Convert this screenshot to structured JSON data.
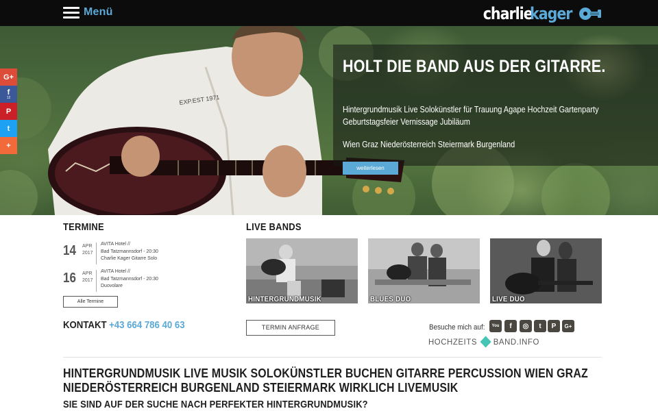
{
  "header": {
    "menu_label": "Menü",
    "logo_part1": "charlie",
    "logo_part2": "kager",
    "accent": "#5aa9d6"
  },
  "hero": {
    "title": "HOLT DIE BAND AUS DER GITARRE.",
    "line1": "Hintergrundmusik Live Solokünstler für Trauung Agape Hochzeit Gartenparty",
    "line2": "Geburtstagsfeier Vernissage Jubiläum",
    "regions": "Wien Graz Niederösterreich Steiermark Burgenland",
    "button": "weiterlesen"
  },
  "share": {
    "items": [
      {
        "icon": "google-plus-icon",
        "glyph": "G+"
      },
      {
        "icon": "facebook-icon",
        "glyph": "f",
        "count": "12"
      },
      {
        "icon": "pinterest-icon",
        "glyph": "P"
      },
      {
        "icon": "twitter-icon",
        "glyph": "t"
      },
      {
        "icon": "more-plus-icon",
        "glyph": "+"
      }
    ]
  },
  "termine": {
    "heading": "TERMINE",
    "events": [
      {
        "day": "14",
        "month": "APR",
        "year": "2017",
        "l1": "AVITA Hotel //",
        "l2": "Bad Tatzmannsdorf - 20:30",
        "l3": "Charlie Kager Gitarre Solo"
      },
      {
        "day": "16",
        "month": "APR",
        "year": "2017",
        "l1": "AVITA Hotel //",
        "l2": "Bad Tatzmannsdorf - 20:30",
        "l3": "Duovolare"
      }
    ],
    "all_button": "Alle Termine"
  },
  "contact": {
    "label": "KONTAKT",
    "phone": "+43 664 786 40 63"
  },
  "bands": {
    "heading": "LIVE BANDS",
    "items": [
      {
        "label": "HINTERGRUNDMUSIK"
      },
      {
        "label": "BLUES DUO"
      },
      {
        "label": "LIVE DUO"
      }
    ],
    "request_button": "TERMIN ANFRAGE"
  },
  "social": {
    "visit_label": "Besuche mich auf:",
    "icons": [
      {
        "name": "youtube-icon",
        "glyph": "You"
      },
      {
        "name": "facebook-icon",
        "glyph": "f"
      },
      {
        "name": "instagram-icon",
        "glyph": "◎"
      },
      {
        "name": "twitter-icon",
        "glyph": "t"
      },
      {
        "name": "pinterest-icon",
        "glyph": "P"
      },
      {
        "name": "google-plus-icon",
        "glyph": "G+"
      }
    ],
    "hz_left": "HOCHZEITS",
    "hz_right": "BAND.INFO"
  },
  "content": {
    "heading": "HINTERGRUNDMUSIK LIVE MUSIK SOLOKÜNSTLER BUCHEN GITARRE PERCUSSION WIEN GRAZ NIEDERÖSTERREICH BURGENLAND STEIERMARK WIRKLICH LIVEMUSIK",
    "subheading": "SIE SIND AUF DER SUCHE NACH PERFEKTER HINTERGRUNDMUSIK?"
  }
}
